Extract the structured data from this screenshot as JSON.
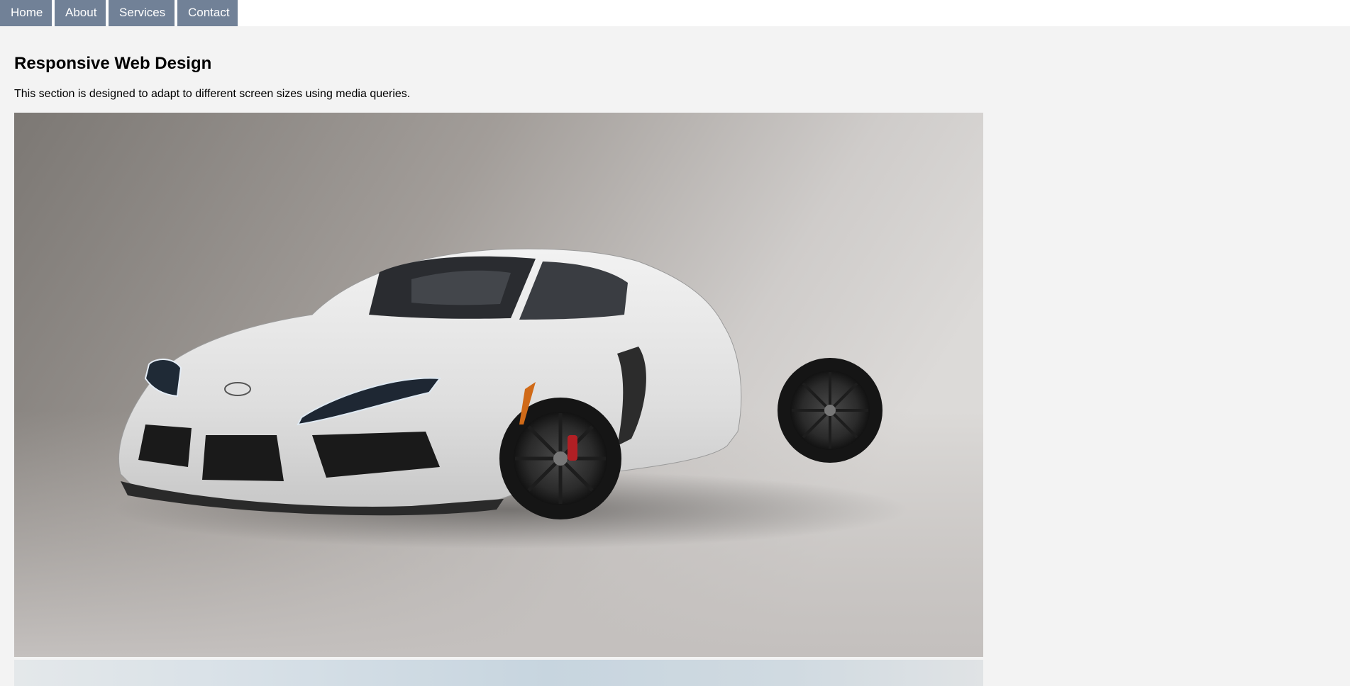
{
  "nav": {
    "items": [
      {
        "label": "Home"
      },
      {
        "label": "About"
      },
      {
        "label": "Services"
      },
      {
        "label": "Contact"
      }
    ]
  },
  "main": {
    "title": "Responsive Web Design",
    "description": "This section is designed to adapt to different screen sizes using media queries."
  },
  "images": [
    {
      "subject": "white sports car in studio"
    },
    {
      "subject": "partially visible image with sky"
    }
  ],
  "colors": {
    "nav_bg": "#718197",
    "page_bg": "#f3f3f3"
  }
}
